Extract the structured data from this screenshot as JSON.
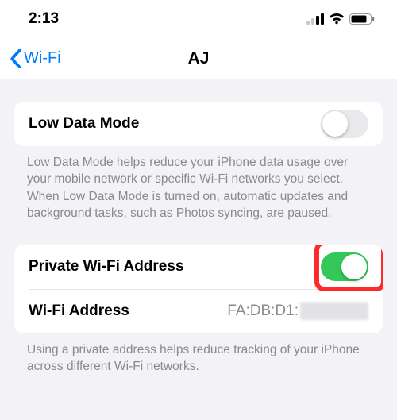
{
  "status": {
    "time": "2:13"
  },
  "nav": {
    "back_label": "Wi-Fi",
    "title": "AJ"
  },
  "group1": {
    "low_data_mode": {
      "label": "Low Data Mode",
      "on": false
    },
    "footer": "Low Data Mode helps reduce your iPhone data usage over your mobile network or specific Wi-Fi networks you select. When Low Data Mode is turned on, automatic updates and background tasks, such as Photos syncing, are paused."
  },
  "group2": {
    "private_addr": {
      "label": "Private Wi-Fi Address",
      "on": true
    },
    "wifi_addr": {
      "label": "Wi-Fi Address",
      "value_prefix": "FA:DB:D1:"
    },
    "footer": "Using a private address helps reduce tracking of your iPhone across different Wi-Fi networks."
  }
}
